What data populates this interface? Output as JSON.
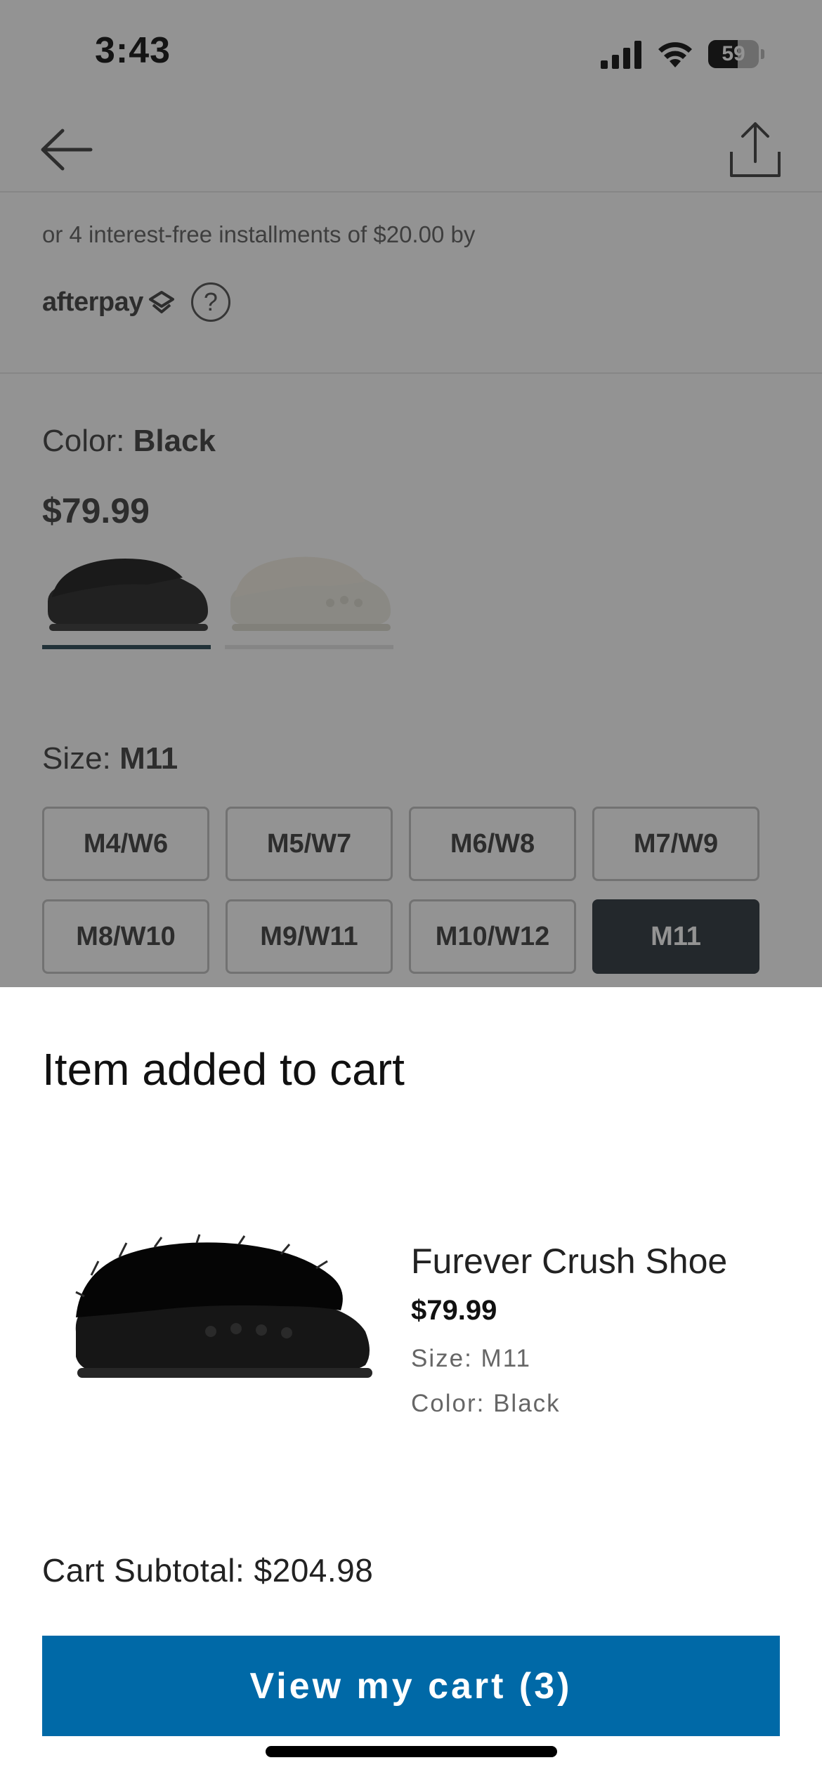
{
  "status_bar": {
    "time": "3:43",
    "battery": "59",
    "battery_level": 0.59,
    "icons": [
      "signal-icon",
      "wifi-icon",
      "battery-icon"
    ]
  },
  "nav": {
    "icons": [
      "back-arrow-icon",
      "share-icon"
    ]
  },
  "payment": {
    "installments_text": "or 4 interest-free installments of $20.00 by",
    "provider_logo": "afterpay",
    "help_symbol": "?"
  },
  "color": {
    "label": "Color:",
    "value": "Black",
    "price": "$79.99",
    "swatches": [
      "Black",
      "Cream"
    ],
    "selected_index": 0
  },
  "size": {
    "label": "Size:",
    "value": "M11",
    "options": [
      "M4/W6",
      "M5/W7",
      "M6/W8",
      "M7/W9",
      "M8/W10",
      "M9/W11",
      "M10/W12",
      "M11"
    ],
    "selected": "M11"
  },
  "sheet": {
    "title": "Item added to cart",
    "product": {
      "name": "Furever Crush Shoe",
      "price": "$79.99",
      "size_line": "Size: M11",
      "color_line": "Color: Black"
    },
    "subtotal": "Cart Subtotal: $204.98",
    "button_label": "View my cart (3)"
  },
  "colors": {
    "primary_button": "#0069a7",
    "selected_size": "#1f2830",
    "overlay": "rgba(40,40,40,0.5)"
  }
}
